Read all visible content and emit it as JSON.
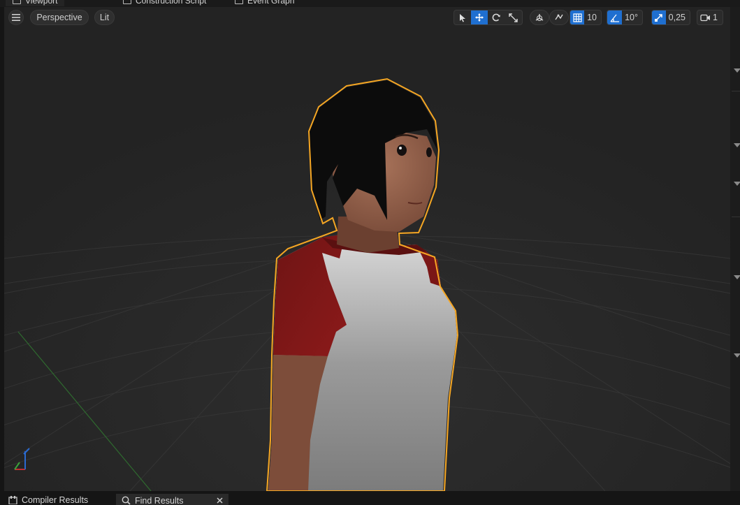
{
  "tabs": [
    {
      "label": "Viewport",
      "active": true
    },
    {
      "label": "Construction Script",
      "active": false
    },
    {
      "label": "Event Graph",
      "active": false
    }
  ],
  "viewport_toolbar": {
    "menu_icon": "hamburger-menu-icon",
    "view_mode": "Perspective",
    "lighting": "Lit",
    "grid_snap_value": "10",
    "rotation_snap_value": "10°",
    "scale_snap_value": "0,25",
    "camera_speed_value": "1",
    "active_color": "#1f6fd0"
  },
  "selection_outline_color": "#f5a623",
  "bottom_tabs": [
    {
      "label": "Compiler Results"
    },
    {
      "label": "Find Results"
    }
  ]
}
